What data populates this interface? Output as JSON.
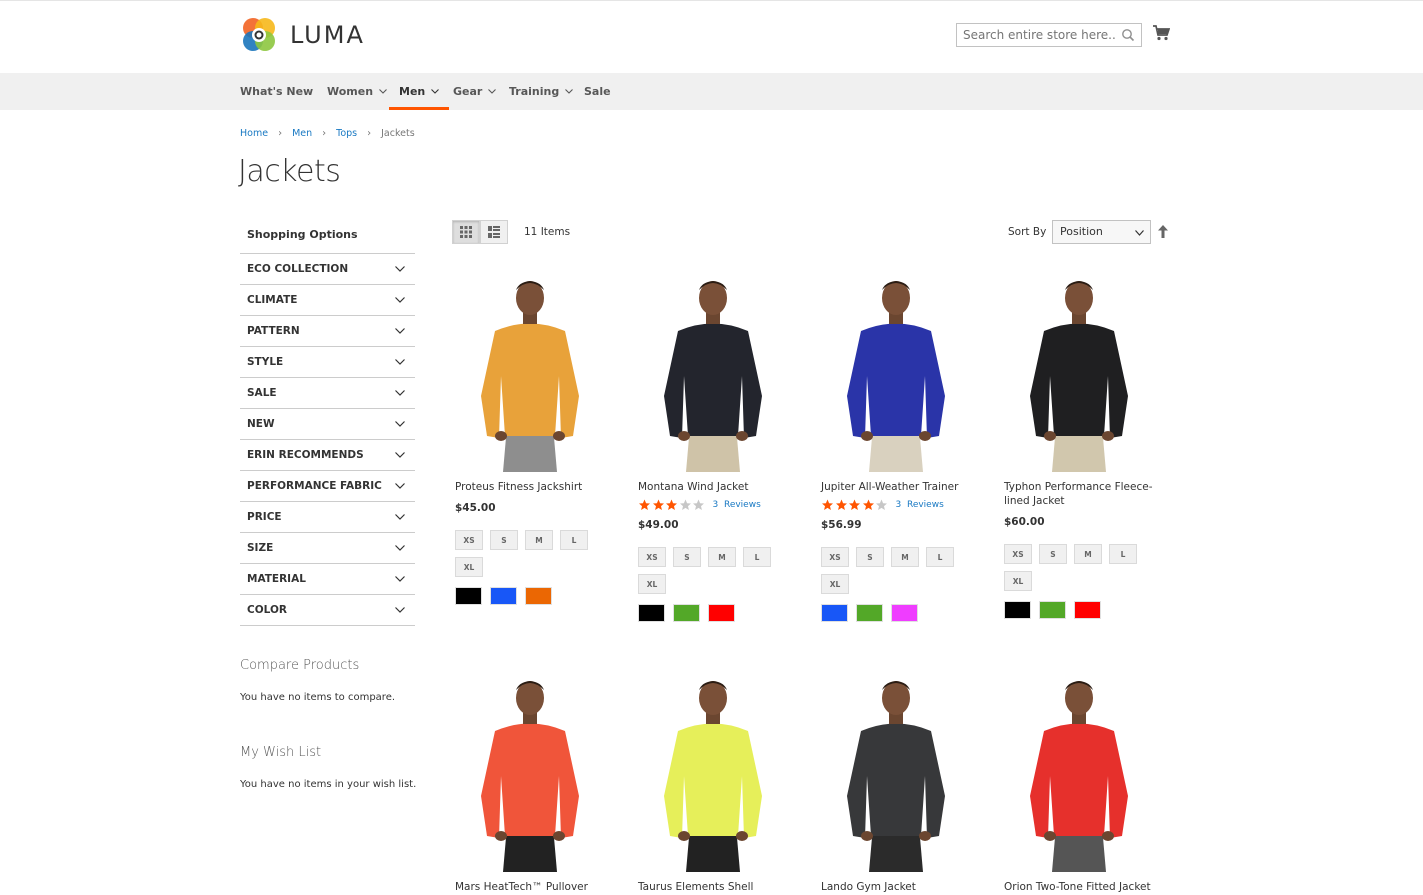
{
  "header": {
    "brand": "LUMA",
    "search_placeholder": "Search entire store here..."
  },
  "nav": {
    "items": [
      {
        "label": "What's New",
        "dropdown": false
      },
      {
        "label": "Women",
        "dropdown": true
      },
      {
        "label": "Men",
        "dropdown": true,
        "active": true
      },
      {
        "label": "Gear",
        "dropdown": true
      },
      {
        "label": "Training",
        "dropdown": true
      },
      {
        "label": "Sale",
        "dropdown": false
      }
    ]
  },
  "breadcrumb": {
    "items": [
      "Home",
      "Men",
      "Tops"
    ],
    "current": "Jackets"
  },
  "page_title": "Jackets",
  "sidebar": {
    "title": "Shopping Options",
    "filters": [
      "ECO COLLECTION",
      "CLIMATE",
      "PATTERN",
      "STYLE",
      "SALE",
      "NEW",
      "ERIN RECOMMENDS",
      "PERFORMANCE FABRIC",
      "PRICE",
      "SIZE",
      "MATERIAL",
      "COLOR"
    ],
    "compare": {
      "title": "Compare Products",
      "text": "You have no items to compare."
    },
    "wishlist": {
      "title": "My Wish List",
      "text": "You have no items in your wish list."
    }
  },
  "toolbar": {
    "items_count": "11 Items",
    "sort_label": "Sort By",
    "sort_value": "Position"
  },
  "products": [
    {
      "name": "Proteus Fitness Jackshirt",
      "price": "$45.00",
      "rating": 0,
      "reviews": "",
      "sizes": [
        "XS",
        "S",
        "M",
        "L",
        "XL"
      ],
      "colors": [
        "#000000",
        "#1857f7",
        "#eb6703"
      ],
      "jacket": "#e8a23a",
      "pants": "#8e8e8e"
    },
    {
      "name": "Montana Wind Jacket",
      "price": "$49.00",
      "rating": 3,
      "reviews": "Reviews",
      "reviews_count": "3",
      "sizes": [
        "XS",
        "S",
        "M",
        "L",
        "XL"
      ],
      "colors": [
        "#000000",
        "#53a828",
        "#ff0000"
      ],
      "jacket": "#23252d",
      "pants": "#cfc3a8"
    },
    {
      "name": "Jupiter All-Weather Trainer",
      "price": "$56.99",
      "rating": 4,
      "reviews": "Reviews",
      "reviews_count": "3",
      "sizes": [
        "XS",
        "S",
        "M",
        "L",
        "XL"
      ],
      "colors": [
        "#1857f7",
        "#53a828",
        "#ef3dff"
      ],
      "jacket": "#2a34a8",
      "pants": "#d9d1bf"
    },
    {
      "name": "Typhon Performance Fleece-lined Jacket",
      "price": "$60.00",
      "rating": 0,
      "reviews": "",
      "sizes": [
        "XS",
        "S",
        "M",
        "L",
        "XL"
      ],
      "colors": [
        "#000000",
        "#53a828",
        "#ff0000"
      ],
      "jacket": "#1f1f21",
      "pants": "#d1c7ad"
    },
    {
      "name": "Mars HeatTech™ Pullover",
      "jacket": "#f0553a",
      "pants": "#222222"
    },
    {
      "name": "Taurus Elements Shell",
      "jacket": "#e6ef5a",
      "pants": "#222222"
    },
    {
      "name": "Lando Gym Jacket",
      "jacket": "#37383a",
      "pants": "#2b2b2b"
    },
    {
      "name": "Orion Two-Tone Fitted Jacket",
      "jacket": "#e6302c",
      "pants": "#555555"
    }
  ],
  "colors": {
    "accent": "#ff5501",
    "link": "#1979c3",
    "star": "#ff5501"
  }
}
